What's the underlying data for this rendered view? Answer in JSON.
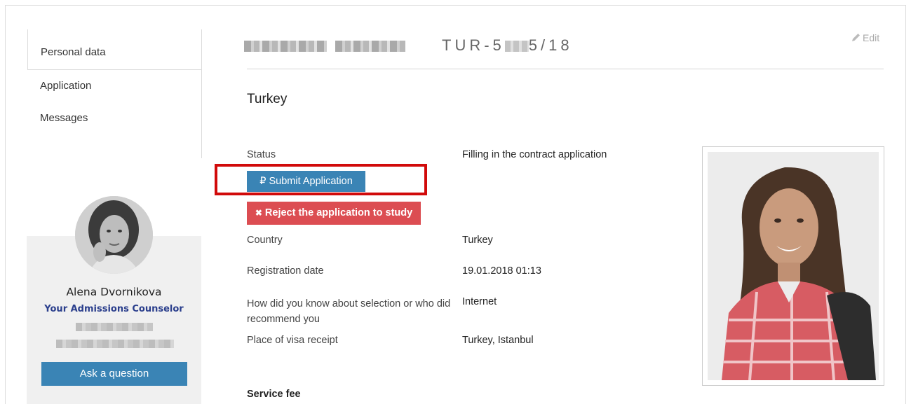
{
  "nav": {
    "items": [
      {
        "label": "Personal data",
        "active": true
      },
      {
        "label": "Application",
        "active": false
      },
      {
        "label": "Messages",
        "active": false
      }
    ]
  },
  "counselor": {
    "name": "Alena Dvornikova",
    "role": "Your Admissions Counselor",
    "ask_button": "Ask a question",
    "card_bg": "#f0f0f0",
    "role_color": "#2a3e8c"
  },
  "header": {
    "application_id_prefix": "TUR-5",
    "application_id_suffix": "5/18",
    "edit_label": "Edit",
    "edit_icon": "pencil-icon"
  },
  "main": {
    "country_title": "Turkey",
    "status": {
      "label": "Status",
      "value": "Filling in the contract application"
    },
    "submit_button": {
      "label": "Submit Application",
      "icon": "₽",
      "color": "#3a84b5",
      "highlighted": true,
      "highlight_color": "#d10a0a"
    },
    "reject_button": {
      "label": "Reject the application to study",
      "icon": "✖",
      "color": "#dc4d52"
    },
    "rows": [
      {
        "label": "Country",
        "value": "Turkey"
      },
      {
        "label": "Registration date",
        "value": "19.01.2018 01:13"
      },
      {
        "label": "How did you know about selection or who did recommend you",
        "value": "Internet"
      },
      {
        "label": "Place of visa receipt",
        "value": "Turkey, Istanbul"
      }
    ],
    "service_fee_heading": "Service fee"
  }
}
